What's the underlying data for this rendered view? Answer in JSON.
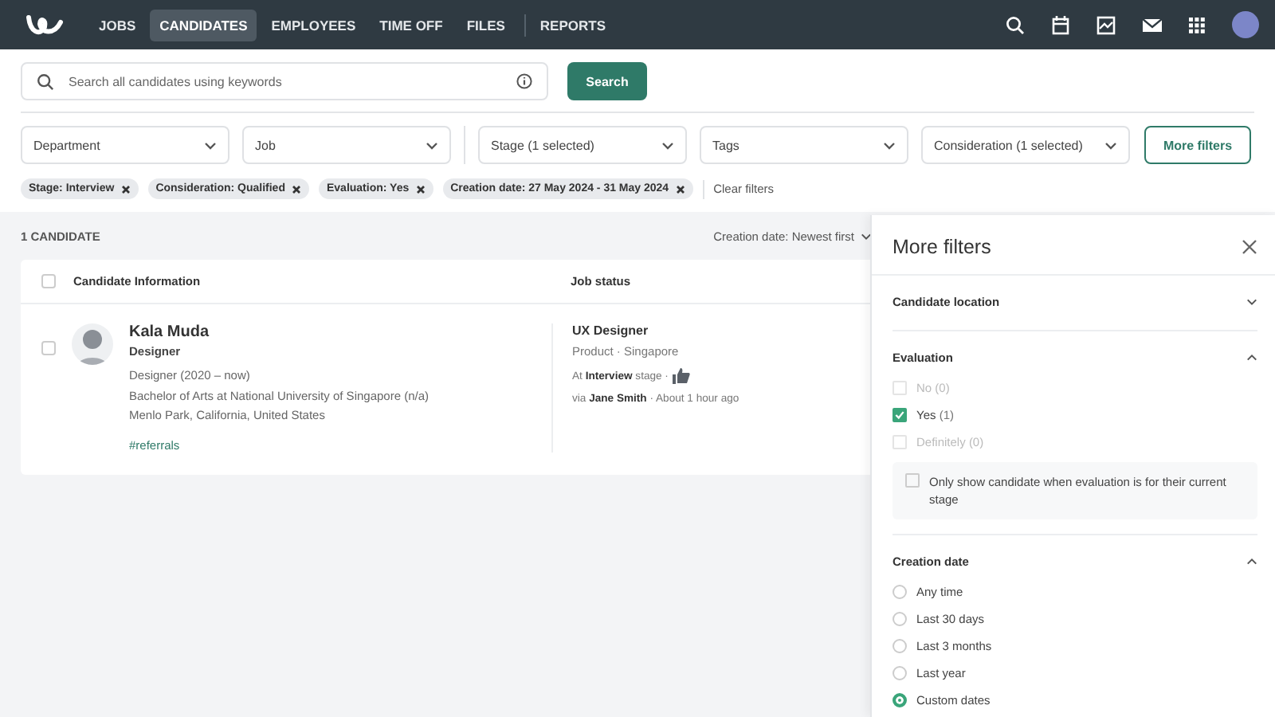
{
  "nav": {
    "items": [
      {
        "label": "JOBS",
        "selected": false
      },
      {
        "label": "CANDIDATES",
        "selected": true
      },
      {
        "label": "EMPLOYEES",
        "selected": false
      },
      {
        "label": "TIME OFF",
        "selected": false
      },
      {
        "label": "FILES",
        "selected": false
      },
      {
        "label": "REPORTS",
        "selected": false
      }
    ]
  },
  "search": {
    "placeholder": "Search all candidates using keywords",
    "button": "Search"
  },
  "filters": [
    "Department",
    "Job",
    "Stage (1 selected)",
    "Tags",
    "Consideration (1 selected)"
  ],
  "more_filters_button": "More filters",
  "active_filters": [
    "Stage: Interview",
    "Consideration: Qualified",
    "Evaluation: Yes",
    "Creation date: 27 May 2024 - 31 May 2024"
  ],
  "clear_filters": "Clear filters",
  "results": {
    "count": "1 CANDIDATE",
    "sort": "Creation date: Newest first"
  },
  "table": {
    "columns": [
      "Candidate Information",
      "Job status"
    ],
    "select_all_checked": false,
    "rows": [
      {
        "checked": false,
        "name": "Kala Muda",
        "title": "Designer",
        "details": [
          "Designer (2020 – now)",
          "Bachelor of Arts at National University of Singapore (n/a)",
          "Menlo Park, California, United States"
        ],
        "tag": "#referrals",
        "job": "UX Designer",
        "job_meta": "Product · Singapore",
        "stage": "At **Interview** stage ·",
        "source": "via **Jane Smith** · About 1 hour ago"
      }
    ]
  },
  "panel": {
    "title": "More filters",
    "sections": [
      {
        "title": "Candidate location",
        "expanded": false
      },
      {
        "title": "Evaluation",
        "expanded": true,
        "options": [
          {
            "kind": "checkbox",
            "label": "No",
            "count": "(0)",
            "checked": false,
            "disabled": true
          },
          {
            "kind": "checkbox",
            "label": "Yes",
            "count": "(1)",
            "checked": true,
            "disabled": false
          },
          {
            "kind": "checkbox",
            "label": "Definitely",
            "count": "(0)",
            "checked": false,
            "disabled": true
          }
        ],
        "note": {
          "label": "Only show candidate when evaluation is for their current stage",
          "checked": false
        }
      },
      {
        "title": "Creation date",
        "expanded": true,
        "options": [
          {
            "kind": "radio",
            "label": "Any time",
            "selected": false
          },
          {
            "kind": "radio",
            "label": "Last 30 days",
            "selected": false
          },
          {
            "kind": "radio",
            "label": "Last 3 months",
            "selected": false
          },
          {
            "kind": "radio",
            "label": "Last year",
            "selected": false
          },
          {
            "kind": "radio",
            "label": "Custom dates",
            "selected": true
          }
        ]
      }
    ]
  }
}
